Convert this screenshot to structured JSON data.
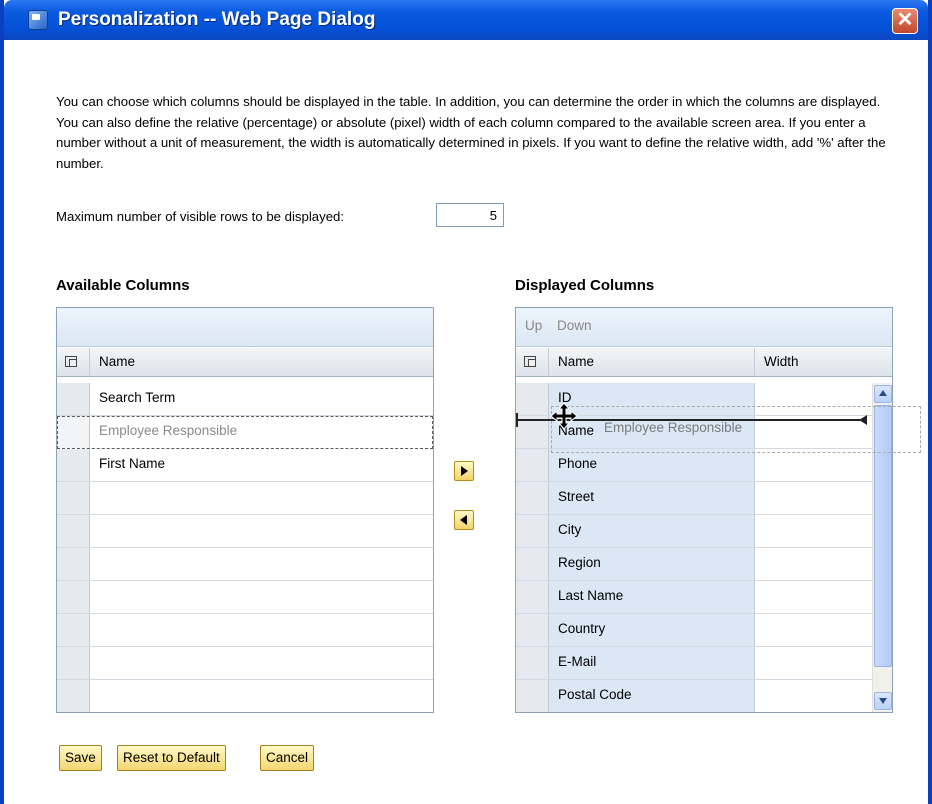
{
  "window": {
    "title": "Personalization -- Web Page Dialog",
    "close": "✕"
  },
  "description": "You can choose which columns should be displayed in the table. In addition, you can determine the order in which the columns are displayed. You can also define the relative (percentage) or absolute (pixel) width of each column compared to the available screen area. If you enter a number without a unit of measurement, the width is automatically determined in pixels. If you want to define the relative width, add '%' after the number.",
  "max_rows": {
    "label": "Maximum number of visible rows to be displayed:",
    "value": "5"
  },
  "available": {
    "title": "Available Columns",
    "header_name": "Name",
    "rows": [
      "Search Term",
      "Employee Responsible",
      "First Name"
    ]
  },
  "displayed": {
    "title": "Displayed Columns",
    "toolbar": {
      "up": "Up",
      "down": "Down"
    },
    "header_name": "Name",
    "header_width": "Width",
    "rows": [
      "ID",
      "Name",
      "Phone",
      "Street",
      "City",
      "Region",
      "Last Name",
      "Country",
      "E-Mail",
      "Postal Code"
    ],
    "drag_ghost": "Employee Responsible"
  },
  "buttons": {
    "save": "Save",
    "reset": "Reset to Default",
    "cancel": "Cancel"
  },
  "colors": {
    "titlebar": "#0551d8",
    "button": "#f3d670",
    "selected_column": "#dbe7f4"
  }
}
